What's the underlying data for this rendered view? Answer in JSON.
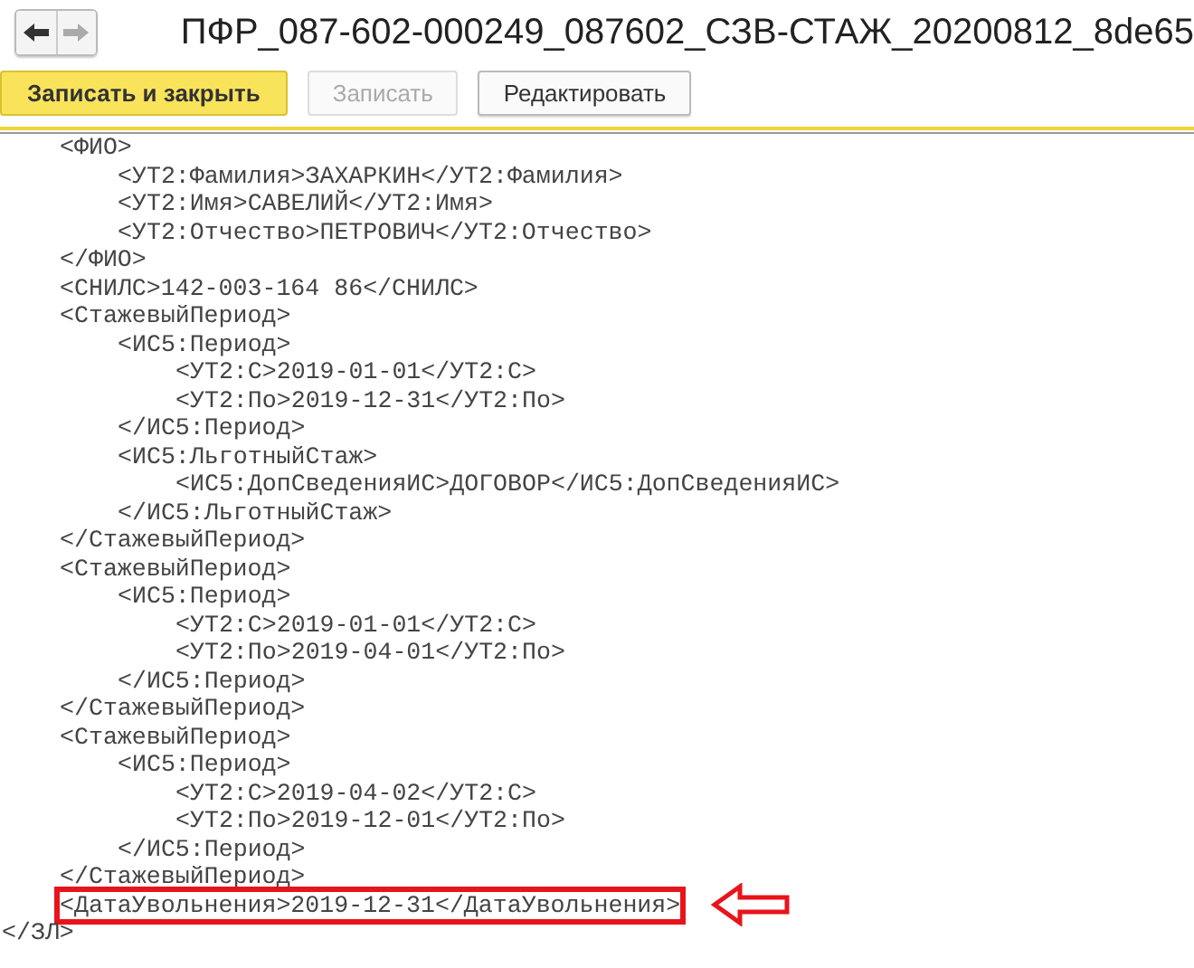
{
  "window": {
    "title": "ПФР_087-602-000249_087602_СЗВ-СТАЖ_20200812_8de65"
  },
  "nav": [
    {
      "kind": "back",
      "disabled": false
    },
    {
      "kind": "forward",
      "disabled": true
    }
  ],
  "buttons": [
    {
      "label": "Записать и закрыть",
      "kind": "primary",
      "disabled": false
    },
    {
      "label": "Записать",
      "kind": "normal",
      "disabled": true
    },
    {
      "label": "Редактировать",
      "kind": "normal",
      "disabled": false
    }
  ],
  "lines": [
    {
      "text": "<ФИО>",
      "highlighted": false,
      "children": [
        {
          "text": "<УТ2:Фамилия>ЗАХАРКИН</УТ2:Фамилия>",
          "highlighted": false
        },
        {
          "text": "<УТ2:Имя>САВЕЛИЙ</УТ2:Имя>",
          "highlighted": false
        },
        {
          "text": "<УТ2:Отчество>ПЕТРОВИЧ</УТ2:Отчество>",
          "highlighted": false
        }
      ]
    },
    {
      "text": "</ФИО>",
      "highlighted": false
    },
    {
      "text": "<СНИЛС>142-003-164 86</СНИЛС>",
      "highlighted": false
    },
    {
      "text": "<СтажевыйПериод>",
      "highlighted": false,
      "children": [
        {
          "text": "<ИС5:Период>",
          "highlighted": false,
          "children": [
            {
              "text": "<УТ2:С>2019-01-01</УТ2:С>",
              "highlighted": false
            },
            {
              "text": "<УТ2:По>2019-12-31</УТ2:По>",
              "highlighted": false
            }
          ]
        },
        {
          "text": "</ИС5:Период>",
          "highlighted": false
        },
        {
          "text": "<ИС5:ЛьготныйСтаж>",
          "highlighted": false,
          "children": [
            {
              "text": "<ИС5:ДопСведенияИС>ДОГОВОР</ИС5:ДопСведенияИС>",
              "highlighted": false
            }
          ]
        },
        {
          "text": "</ИС5:ЛьготныйСтаж>",
          "highlighted": false
        }
      ]
    },
    {
      "text": "</СтажевыйПериод>",
      "highlighted": false
    },
    {
      "text": "<СтажевыйПериод>",
      "highlighted": false,
      "children": [
        {
          "text": "<ИС5:Период>",
          "highlighted": false,
          "children": [
            {
              "text": "<УТ2:С>2019-01-01</УТ2:С>",
              "highlighted": false
            },
            {
              "text": "<УТ2:По>2019-04-01</УТ2:По>",
              "highlighted": false
            }
          ]
        },
        {
          "text": "</ИС5:Период>",
          "highlighted": false
        }
      ]
    },
    {
      "text": "</СтажевыйПериод>",
      "highlighted": false
    },
    {
      "text": "<СтажевыйПериод>",
      "highlighted": false,
      "children": [
        {
          "text": "<ИС5:Период>",
          "highlighted": false,
          "children": [
            {
              "text": "<УТ2:С>2019-04-02</УТ2:С>",
              "highlighted": false
            },
            {
              "text": "<УТ2:По>2019-12-01</УТ2:По>",
              "highlighted": false
            }
          ]
        },
        {
          "text": "</ИС5:Период>",
          "highlighted": false
        }
      ]
    },
    {
      "text": "</СтажевыйПериод>",
      "highlighted": false
    },
    {
      "text": "<ДатаУвольнения>2019-12-31</ДатаУвольнения>",
      "highlighted": true
    }
  ],
  "closing_line": "</ЗЛ>"
}
